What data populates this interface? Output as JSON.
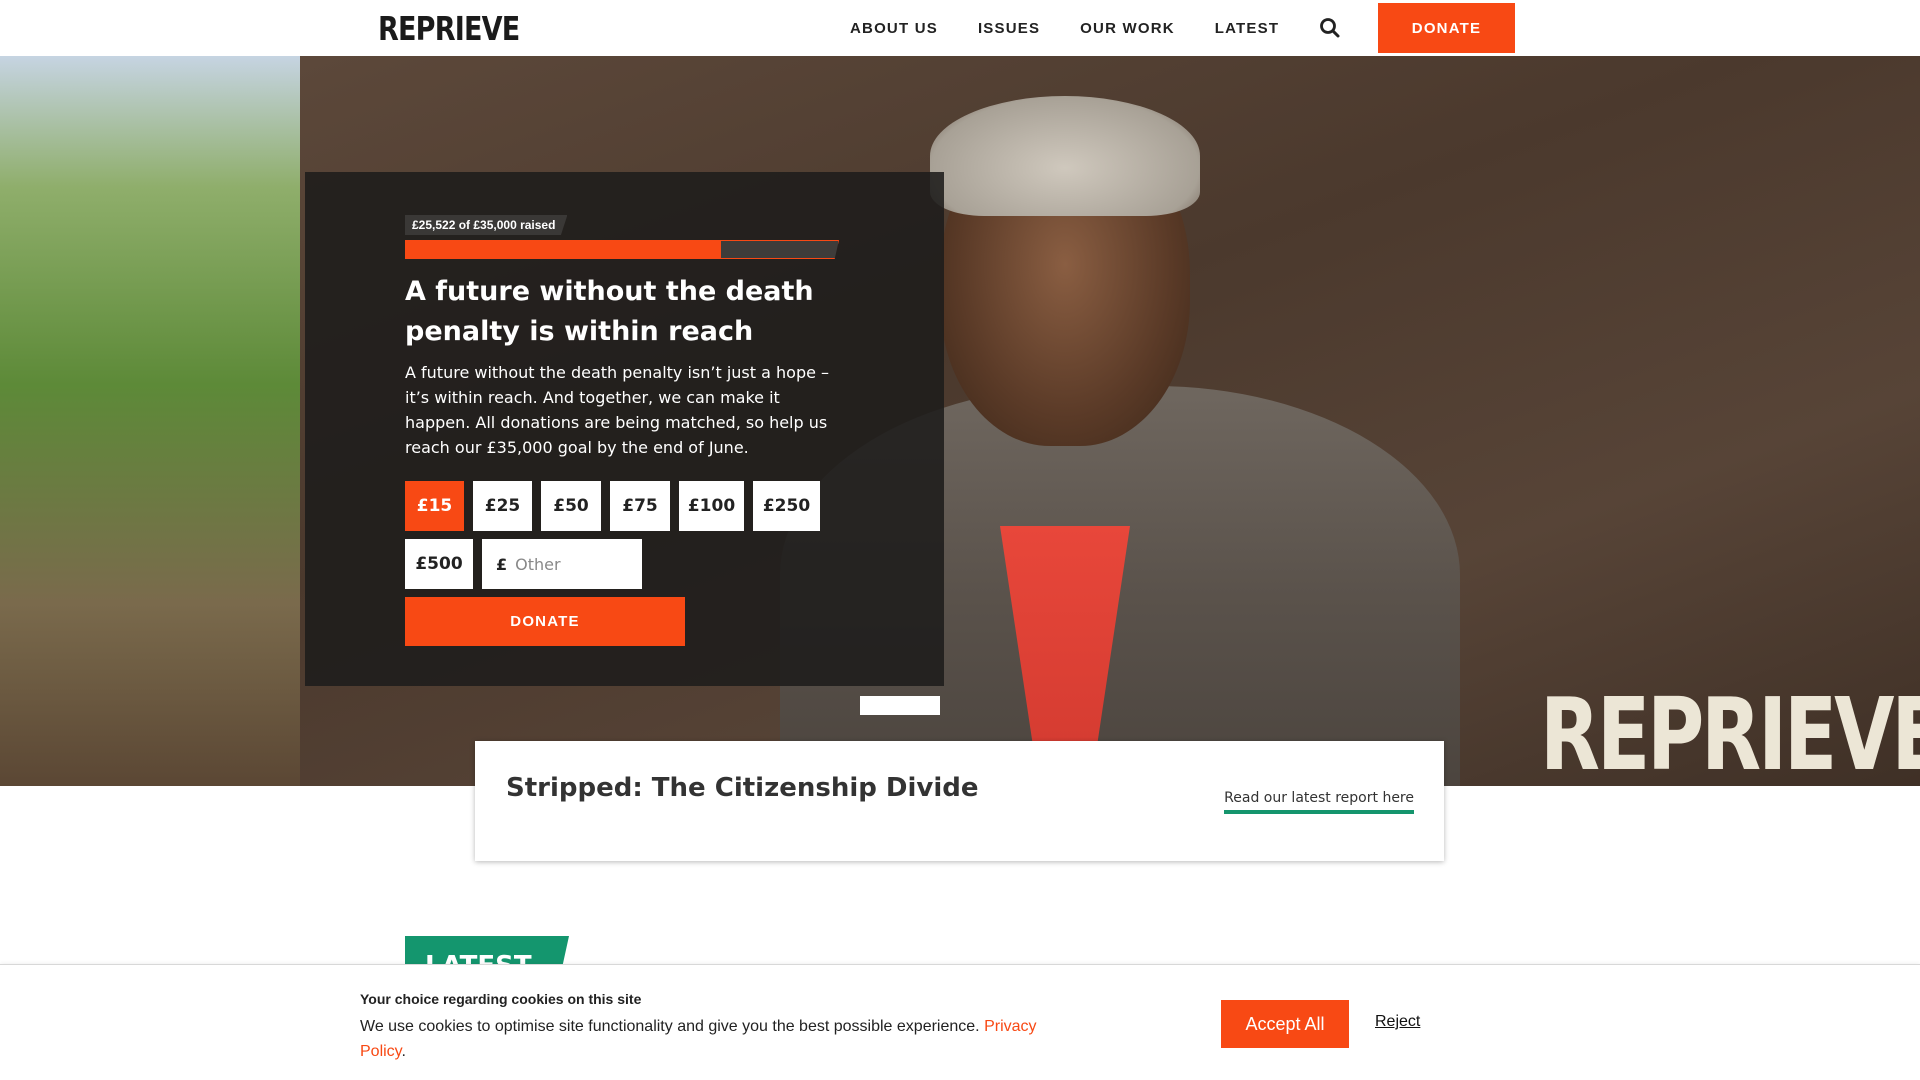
{
  "header": {
    "logo_text": "REPRIEVE",
    "nav": [
      {
        "label": "ABOUT US"
      },
      {
        "label": "ISSUES"
      },
      {
        "label": "OUR WORK"
      },
      {
        "label": "LATEST"
      }
    ],
    "search_icon": "search-icon",
    "donate_label": "DONATE"
  },
  "hero": {
    "watermark_text": "REPRIEVE"
  },
  "donation": {
    "raised_text": "£25,522 of £35,000 raised",
    "raised_amount": 25522,
    "goal_amount": 35000,
    "progress_fraction": 0.729,
    "title": "A future without the death penalty is within reach",
    "body": "A future without the death penalty isn’t just a hope – it’s within reach. And together, we can make it happen. All donations are being matched, so help us reach our £35,000 goal by the end of June.",
    "amounts": [
      {
        "label": "£15",
        "selected": true
      },
      {
        "label": "£25",
        "selected": false
      },
      {
        "label": "£50",
        "selected": false
      },
      {
        "label": "£75",
        "selected": false
      },
      {
        "label": "£100",
        "selected": false
      },
      {
        "label": "£250",
        "selected": false
      },
      {
        "label": "£500",
        "selected": false
      }
    ],
    "other_currency": "£",
    "other_placeholder": "Other",
    "donate_label": "DONATE"
  },
  "feature": {
    "title": "Stripped: The Citizenship Divide",
    "link_label": "Read our latest report here"
  },
  "latest": {
    "label": "LATEST"
  },
  "cookie": {
    "heading": "Your choice regarding cookies on this site",
    "text": "We use cookies to optimise site functionality and give you the best possible experience. ",
    "policy_link": "Privacy Policy",
    "text_end": ".",
    "accept_label": "Accept All",
    "reject_label": "Reject"
  },
  "colors": {
    "accent": "#f84914",
    "green": "#14966e",
    "panel_bg": "#1e1c1b"
  }
}
